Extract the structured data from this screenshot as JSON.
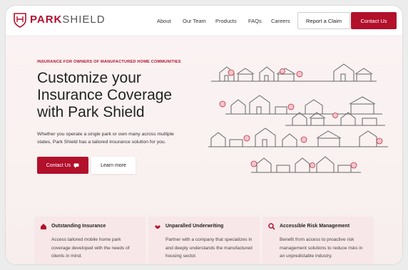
{
  "brand": {
    "name_bold": "PARK",
    "name_rest": "SHIELD",
    "accent": "#b2102b"
  },
  "nav": {
    "items": [
      "About",
      "Our Team",
      "Products",
      "FAQs",
      "Careers"
    ]
  },
  "header": {
    "report_claim": "Report a Claim",
    "contact_us": "Contact Us"
  },
  "hero": {
    "eyebrow": "INSURANCE FOR OWNERS OF MANUFACTURED HOME COMMUNITIES",
    "headline": "Customize your Insurance Coverage with Park Shield",
    "subtext": "Whether you operate a single park or own many across multiple states, Park Shield has a tailored insurance solution for you.",
    "cta_primary": "Contact Us",
    "cta_secondary": "Learn more"
  },
  "cards": [
    {
      "icon": "home-icon",
      "title": "Outstanding Insurance",
      "text": "Access tailored mobile home park coverage developed with the needs of clients in mind."
    },
    {
      "icon": "handshake-icon",
      "title": "Unparalled Underwriting",
      "text": "Partner with a company that specializes in and deeply understands the manufactured housing sector."
    },
    {
      "icon": "search-icon",
      "title": "Accessible Risk Management",
      "text": "Benefit from access to proactive risk management solutions to reduce risks in an unpredictable industry."
    }
  ]
}
